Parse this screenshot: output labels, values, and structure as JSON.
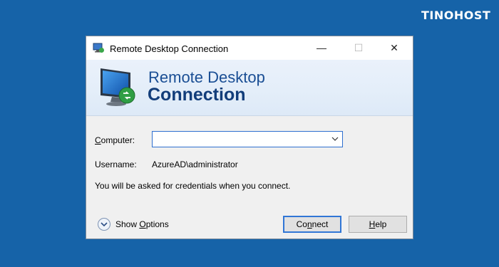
{
  "brand": {
    "logo_text": "TINOHOST"
  },
  "window": {
    "title": "Remote Desktop Connection",
    "controls": {
      "minimize": "—",
      "maximize": "☐",
      "close": "✕"
    }
  },
  "banner": {
    "line1": "Remote Desktop",
    "line2": "Connection",
    "icon": "monitor-icon"
  },
  "form": {
    "computer_label_u": "C",
    "computer_label_rest": "omputer:",
    "computer_value": "",
    "username_label": "Username:",
    "username_value": "AzureAD\\administrator",
    "info_text": "You will be asked for credentials when you connect."
  },
  "footer": {
    "show_options_pre": "Show ",
    "show_options_u": "O",
    "show_options_post": "ptions",
    "connect_pre": "Co",
    "connect_u": "n",
    "connect_post": "nect",
    "help_u": "H",
    "help_post": "elp"
  },
  "colors": {
    "desktop": "#1663a8",
    "accent": "#2e6fcf",
    "banner_text": "#1a4e94"
  }
}
